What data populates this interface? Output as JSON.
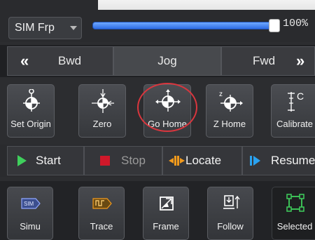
{
  "toolbar": {
    "sim_select": "SIM Frp",
    "speed_percent": 100,
    "speed_label": "100%"
  },
  "jog": {
    "bwd_label": "Bwd",
    "jog_label": "Jog",
    "fwd_label": "Fwd"
  },
  "tools": [
    {
      "label": "Set Origin",
      "icon": "set-origin-icon"
    },
    {
      "label": "Zero",
      "icon": "zero-icon"
    },
    {
      "label": "Go Home",
      "icon": "go-home-icon"
    },
    {
      "label": "Z Home",
      "icon": "z-home-icon"
    },
    {
      "label": "Calibrate",
      "icon": "calibrate-icon"
    }
  ],
  "annotation": {
    "highlight_color": "#d9363e"
  },
  "actions": {
    "start": "Start",
    "stop": "Stop",
    "locate": "Locate",
    "resume": "Resume"
  },
  "bottom": [
    {
      "label": "Simu",
      "icon": "sim-icon"
    },
    {
      "label": "Trace",
      "icon": "trace-icon"
    },
    {
      "label": "Frame",
      "icon": "frame-icon"
    },
    {
      "label": "Follow",
      "icon": "follow-icon"
    },
    {
      "label": "Selected",
      "icon": "selected-icon"
    }
  ],
  "icon_texts": {
    "sim_badge": "SIM",
    "calibrate_letter": "C",
    "zhome_letter": "z"
  },
  "colors": {
    "start_green": "#3fcf5c",
    "stop_red": "#d0182a",
    "locate_orange": "#f29a1c",
    "resume_blue": "#2aa2f0",
    "accent_blue": "#2e6ce3"
  }
}
